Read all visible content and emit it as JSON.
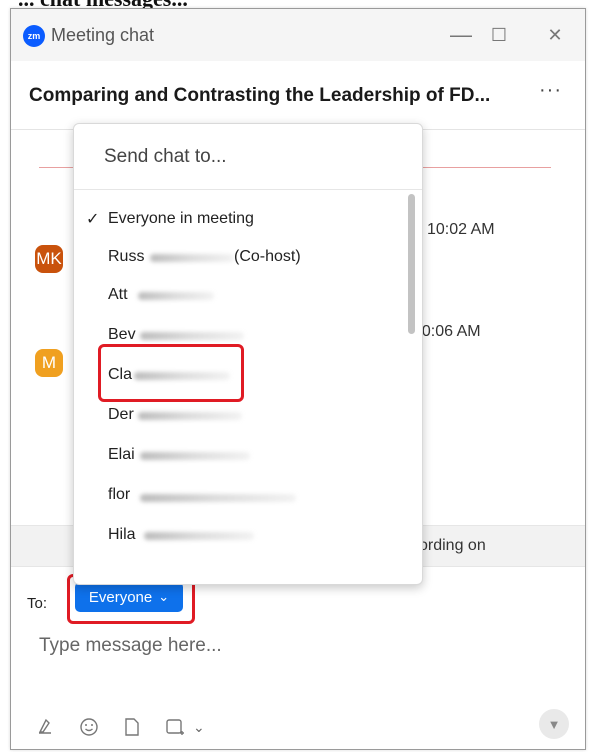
{
  "doc_top_text": "... chat messages...",
  "window": {
    "title": "Meeting chat",
    "minimize": "—",
    "maximize": "☐",
    "close": "✕",
    "logo": "zm"
  },
  "meeting_title": "Comparing and Contrasting the Leadership of FD...",
  "more_icon": "···",
  "chat": {
    "timestamps": [
      "10:02 AM",
      "10:06 AM"
    ],
    "avatars": [
      {
        "initials": "MK",
        "color": "#c9520c"
      },
      {
        "initials": "M",
        "color": "#f0a020"
      }
    ],
    "recording_text": "cording on"
  },
  "dropdown": {
    "header": "Send chat to...",
    "items": [
      {
        "label": "Everyone in meeting",
        "checked": true
      },
      {
        "label": "Russ",
        "suffix": "(Co-host)"
      },
      {
        "label": "Att"
      },
      {
        "label": "Bev"
      },
      {
        "label": "Cla"
      },
      {
        "label": "Der"
      },
      {
        "label": "Elai"
      },
      {
        "label": "flor"
      },
      {
        "label": "Hila"
      }
    ]
  },
  "composer": {
    "to_label": "To:",
    "to_button": "Everyone",
    "placeholder": "Type message here..."
  },
  "icons": [
    "format-icon",
    "emoji-icon",
    "file-icon",
    "screenshot-icon",
    "chevron-down-icon",
    "send-icon"
  ],
  "colors": {
    "accent": "#0e71eb",
    "highlight": "#e01b24"
  }
}
